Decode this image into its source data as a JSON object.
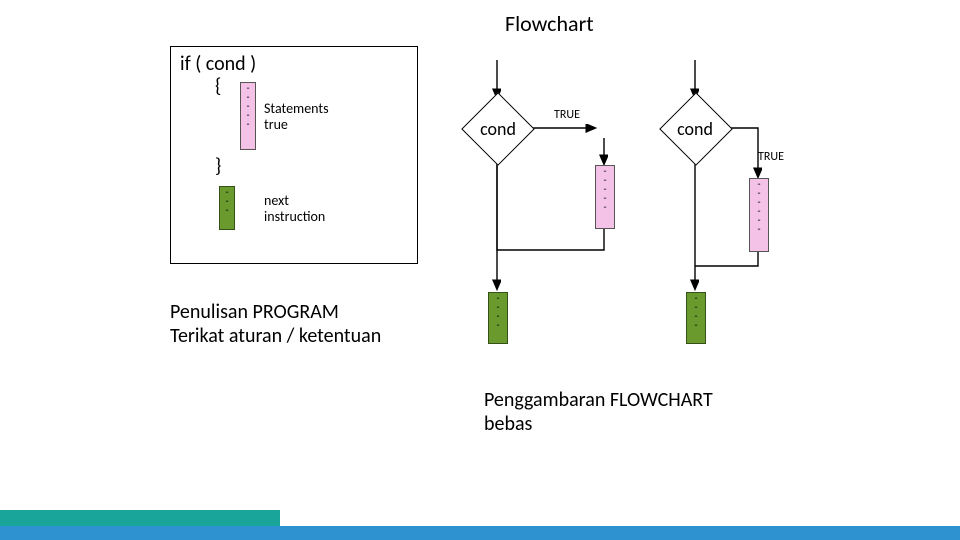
{
  "title": "Flowchart",
  "code": {
    "if_line": "if ( cond )",
    "open_brace": "{",
    "close_brace": "}",
    "stmt_label_1": "Statements",
    "stmt_label_2": "true",
    "next_label_1": "next",
    "next_label_2": "instruction",
    "dash": "-"
  },
  "left_caption_1": "Penulisan PROGRAM",
  "left_caption_2": "Terikat aturan / ketentuan",
  "cond_text": "cond",
  "true_text": "TRUE",
  "right_caption_1": "Penggambaran FLOWCHART",
  "right_caption_2": "bebas"
}
